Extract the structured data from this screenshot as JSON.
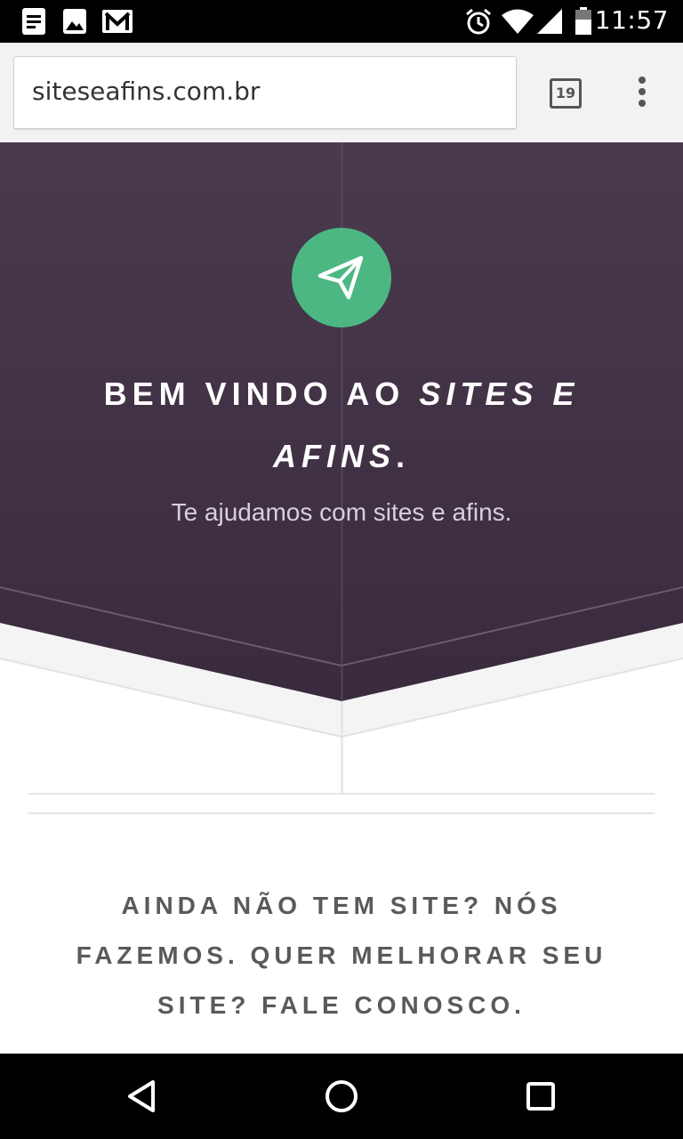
{
  "status_bar": {
    "time": "11:57",
    "left_icons": [
      "document-icon",
      "image-icon",
      "gmail-icon"
    ],
    "right_icons": [
      "alarm-icon",
      "wifi-icon",
      "signal-icon",
      "battery-icon"
    ]
  },
  "browser": {
    "url": "siteseafins.com.br",
    "tab_count": "19"
  },
  "hero": {
    "title_plain": "BEM VINDO AO",
    "title_italic_1": "SITES E",
    "title_italic_2": "AFINS",
    "title_end": ".",
    "subtitle": "Te ajudamos com sites e afins.",
    "icon": "paper-plane-icon",
    "colors": {
      "background": "#3f2d42",
      "icon_circle": "#4cb782"
    }
  },
  "cta": {
    "text": "AINDA NÃO TEM SITE? NÓS FAZEMOS. QUER MELHORAR SEU SITE? FALE CONOSCO."
  },
  "nav_bar": {
    "buttons": [
      "back-icon",
      "home-icon",
      "recents-icon"
    ]
  }
}
